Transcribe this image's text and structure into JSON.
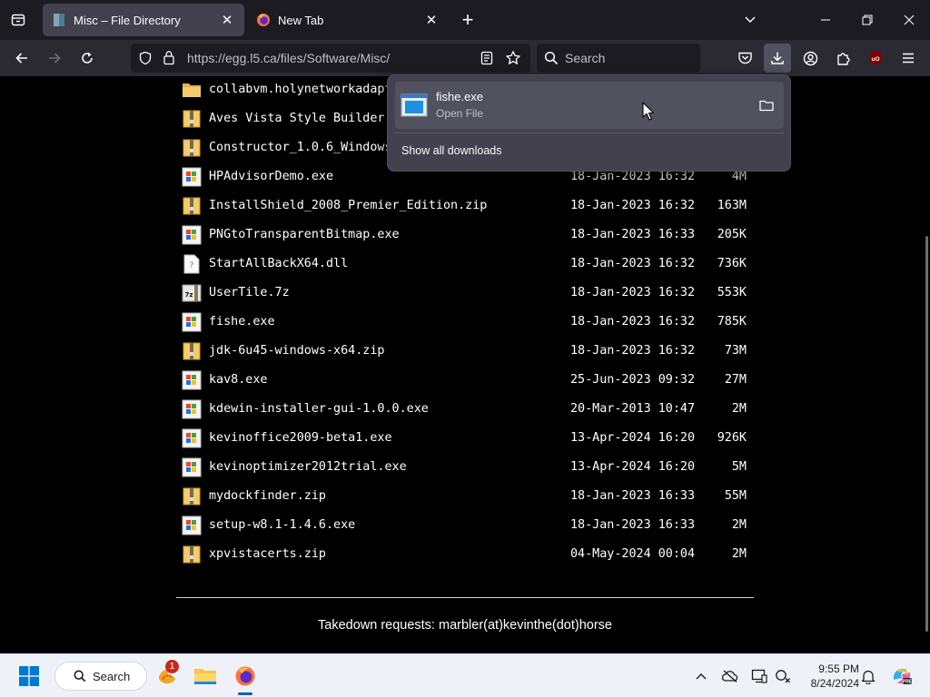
{
  "browser": {
    "tabs": [
      {
        "title": "Misc – File Directory",
        "active": true
      },
      {
        "title": "New Tab",
        "active": false
      }
    ],
    "url": "https://egg.l5.ca/files/Software/Misc/",
    "search_placeholder": "Search"
  },
  "downloads_panel": {
    "item_name": "fishe.exe",
    "item_status": "Open File",
    "show_all_label": "Show all downloads"
  },
  "directory": {
    "rows": [
      {
        "name": "collabvm.holynetworkadapt",
        "date": "",
        "size": "",
        "icon": "folder-icon"
      },
      {
        "name": "Aves Vista Style Builder.",
        "date": "",
        "size": "",
        "icon": "zip-icon"
      },
      {
        "name": "Constructor_1.0.6_Windows",
        "date": "",
        "size": "",
        "icon": "zip-icon"
      },
      {
        "name": "HPAdvisorDemo.exe",
        "date": "18-Jan-2023 16:32",
        "size": "4M",
        "icon": "exe-icon"
      },
      {
        "name": "InstallShield_2008_Premier_Edition.zip",
        "date": "18-Jan-2023 16:32",
        "size": "163M",
        "icon": "zip-icon"
      },
      {
        "name": "PNGtoTransparentBitmap.exe",
        "date": "18-Jan-2023 16:33",
        "size": "205K",
        "icon": "exe-icon"
      },
      {
        "name": "StartAllBackX64.dll",
        "date": "18-Jan-2023 16:32",
        "size": "736K",
        "icon": "unknown-file-icon"
      },
      {
        "name": "UserTile.7z",
        "date": "18-Jan-2023 16:32",
        "size": "553K",
        "icon": "archive-7z-icon"
      },
      {
        "name": "fishe.exe",
        "date": "18-Jan-2023 16:32",
        "size": "785K",
        "icon": "exe-icon"
      },
      {
        "name": "jdk-6u45-windows-x64.zip",
        "date": "18-Jan-2023 16:32",
        "size": "73M",
        "icon": "zip-icon"
      },
      {
        "name": "kav8.exe",
        "date": "25-Jun-2023 09:32",
        "size": "27M",
        "icon": "exe-icon"
      },
      {
        "name": "kdewin-installer-gui-1.0.0.exe",
        "date": "20-Mar-2013 10:47",
        "size": "2M",
        "icon": "exe-icon"
      },
      {
        "name": "kevinoffice2009-beta1.exe",
        "date": "13-Apr-2024 16:20",
        "size": "926K",
        "icon": "exe-icon"
      },
      {
        "name": "kevinoptimizer2012trial.exe",
        "date": "13-Apr-2024 16:20",
        "size": "5M",
        "icon": "exe-icon"
      },
      {
        "name": "mydockfinder.zip",
        "date": "18-Jan-2023 16:33",
        "size": "55M",
        "icon": "zip-icon"
      },
      {
        "name": "setup-w8.1-1.4.6.exe",
        "date": "18-Jan-2023 16:33",
        "size": "2M",
        "icon": "exe-icon"
      },
      {
        "name": "xpvistacerts.zip",
        "date": "04-May-2024 00:04",
        "size": "2M",
        "icon": "zip-icon"
      }
    ],
    "footer": "Takedown requests: marbler(at)kevinthe(dot)horse"
  },
  "taskbar": {
    "search_label": "Search",
    "notification_badge": "1",
    "time": "9:55 PM",
    "date": "8/24/2024"
  },
  "colors": {
    "page_bg": "#000000",
    "chrome_dark": "#1c1b22",
    "chrome_mid": "#2b2a33",
    "panel_bg": "#42414d",
    "taskbar_bg": "#eef2f8",
    "accent": "#005fb8"
  }
}
